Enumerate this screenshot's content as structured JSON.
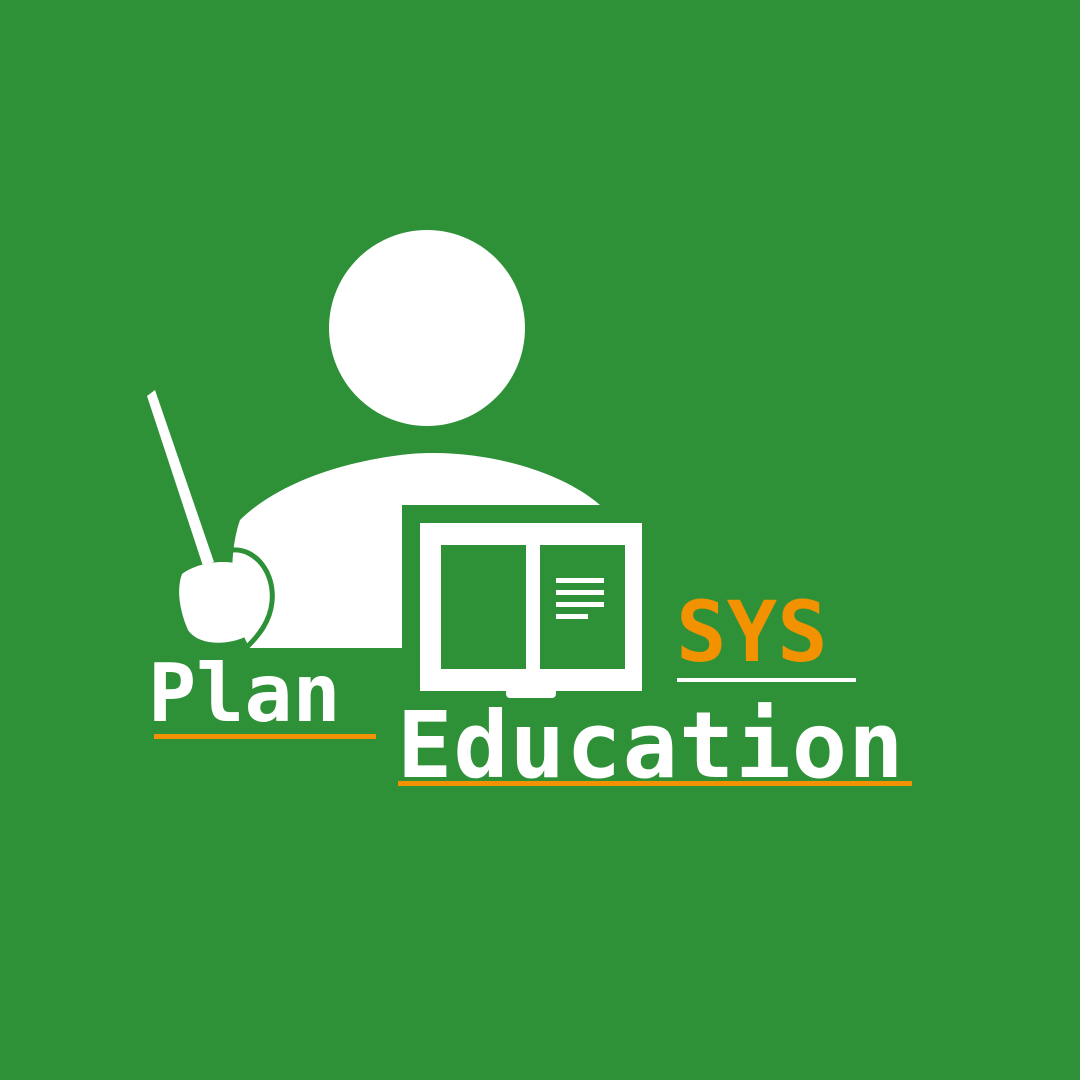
{
  "logo": {
    "word_plan": "Plan",
    "word_sys": "SYS",
    "word_education": "Education"
  },
  "colors": {
    "background": "#2e9137",
    "foreground": "#ffffff",
    "accent": "#f39200"
  },
  "icons": [
    "teacher-icon",
    "pointer-stick-icon",
    "open-book-icon"
  ]
}
